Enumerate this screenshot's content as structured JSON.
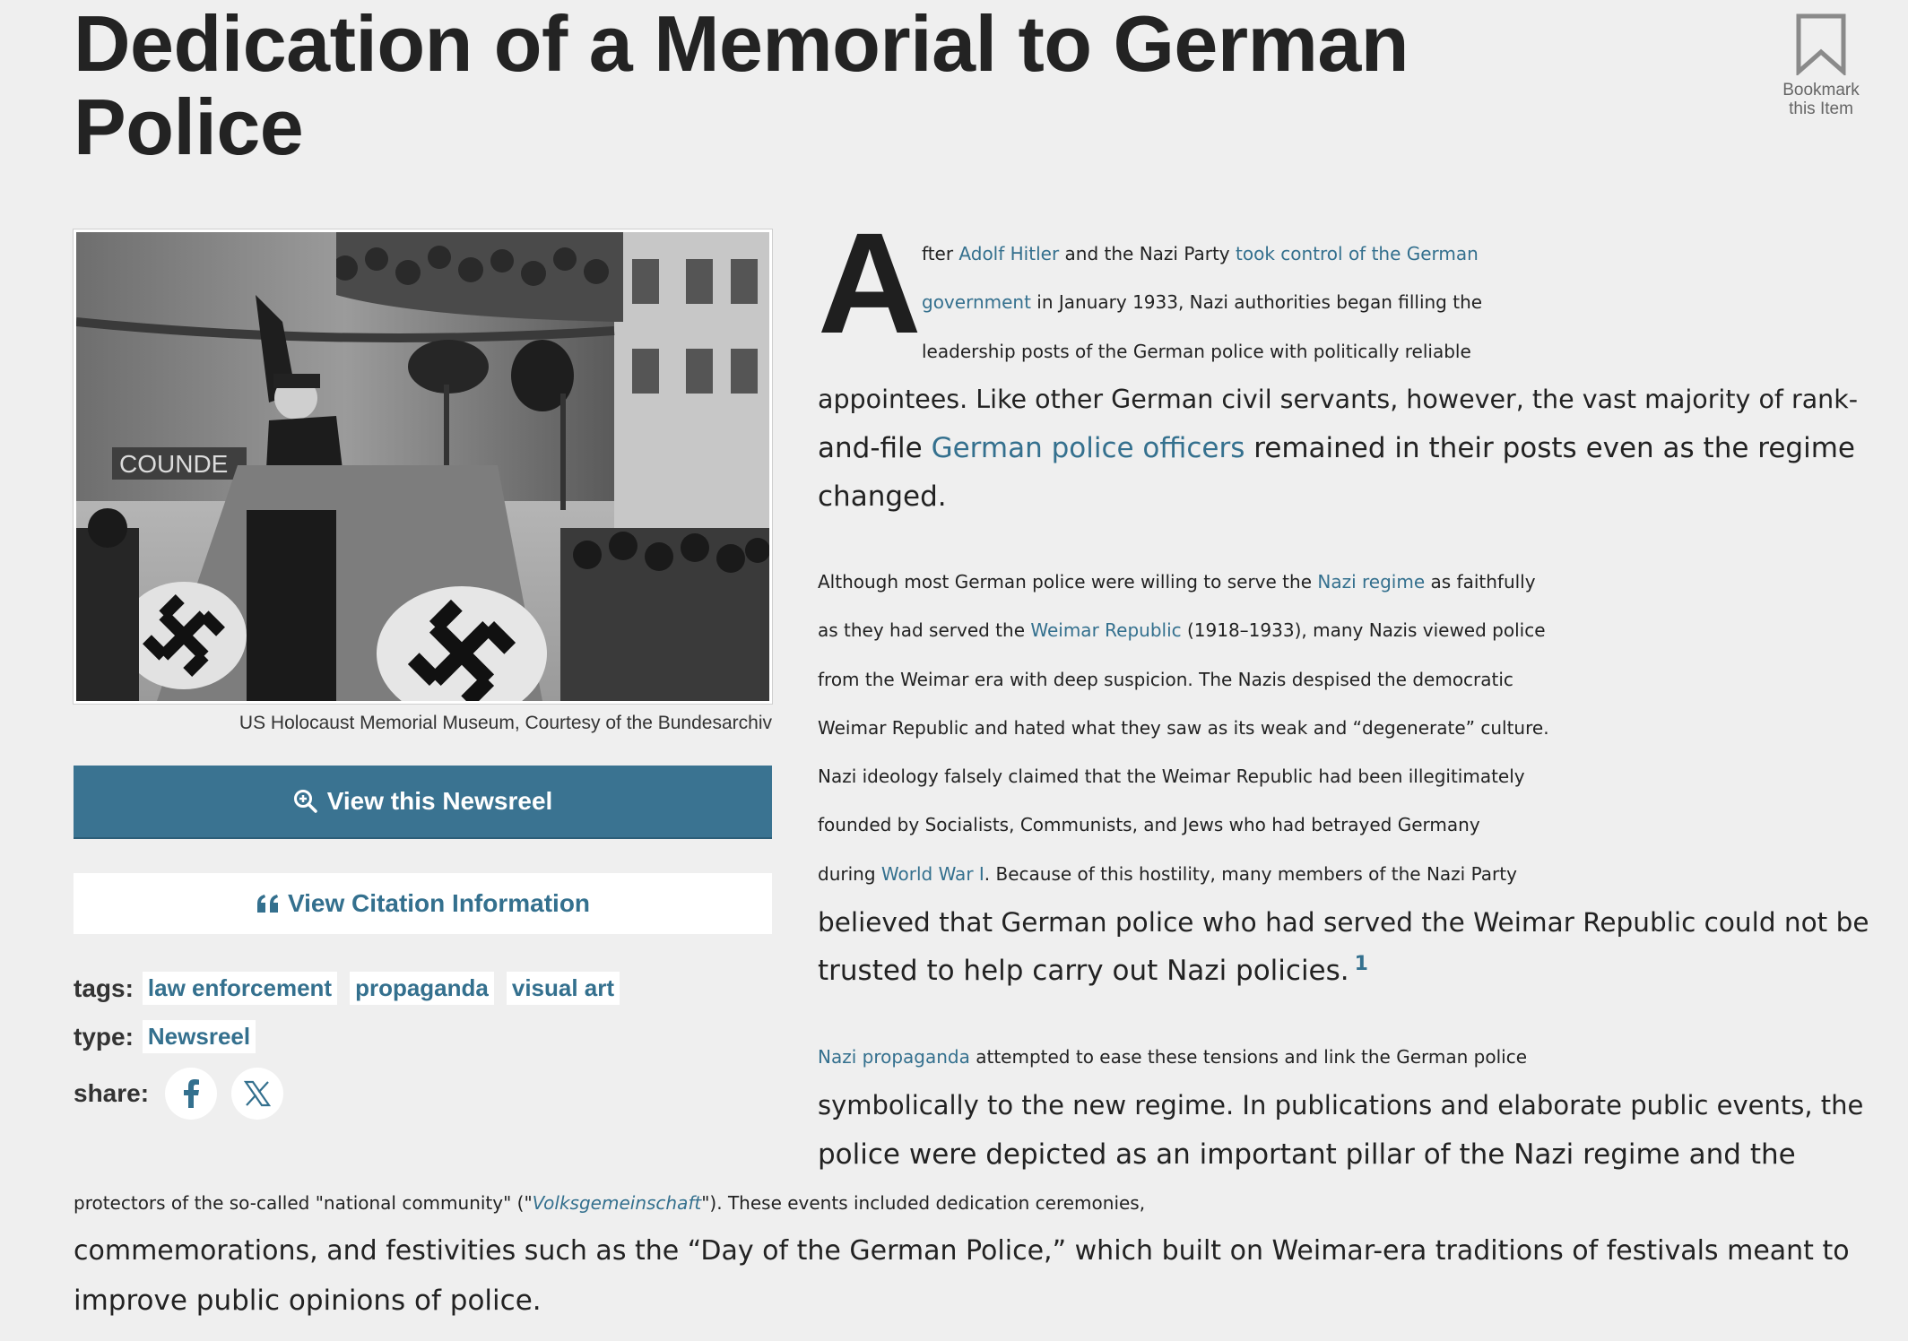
{
  "page": {
    "title_line1": "Dedication of a Memorial to German",
    "title_line2": "Police"
  },
  "bookmark": {
    "line1": "Bookmark",
    "line2": "this Item",
    "icon": "bookmark-icon"
  },
  "figure": {
    "caption": "US Holocaust Memorial Museum, Courtesy of the Bundesarchiv",
    "sign_text": "COUNDE"
  },
  "actions": {
    "view_newsreel": "View this Newsreel",
    "view_citation": "View Citation Information"
  },
  "meta": {
    "tags_label": "tags:",
    "tags": [
      "law enforcement",
      "propaganda",
      "visual art"
    ],
    "type_label": "type:",
    "type_value": "Newsreel",
    "share_label": "share:"
  },
  "article": {
    "dropcap": "A",
    "p1": {
      "l1a": "fter ",
      "l1_link1": "Adolf Hitler",
      "l1b": " and the Nazi Party ",
      "l1_link2": "took control of the German",
      "l2_link2": "government",
      "l2b": " in January 1933, Nazi authorities began filling the",
      "l3": "leadership posts of the German police with politically reliable",
      "l4": "appointees. Like other German civil servants, however, the vast majority of rank-",
      "l5a": "and-file ",
      "l5_link": "German police officers",
      "l5b": " remained in their posts even as the regime",
      "l6": "changed."
    },
    "p2": {
      "l1a": "Although most German police were willing to serve the ",
      "l1_link": "Nazi regime",
      "l1b": " as faithfully",
      "l2a": "as they had served the ",
      "l2_link": "Weimar Republic",
      "l2b": " (1918–1933), many Nazis viewed police",
      "l3": "from the Weimar era with deep suspicion. The Nazis despised the democratic",
      "l4": "Weimar Republic and hated what they saw as its weak and “degenerate” culture.",
      "l5": "Nazi ideology falsely claimed that the Weimar Republic had been illegitimately",
      "l6": "founded by Socialists, Communists, and Jews who had betrayed Germany",
      "l7a": "during ",
      "l7_link": "World War I",
      "l7b": ". Because of this hostility, many members of the Nazi Party",
      "l8": "believed that German police who had served the Weimar Republic could not be",
      "l9": "trusted to help carry out Nazi policies.",
      "footnote": "1"
    },
    "p3": {
      "l1_link": "Nazi propaganda",
      "l1b": " attempted to ease these tensions and link the German police",
      "l2": "symbolically to the new regime. In publications and elaborate public events, the",
      "l3": "police were depicted as an important pillar of the Nazi regime and the",
      "l4a": "protectors of the so-called \"national community\" (\"",
      "l4_link": "Volksgemeinschaft",
      "l4b": "\"). These events included dedication ceremonies,",
      "l5": "commemorations, and festivities such as the “Day of the German Police,” which built on Weimar-era traditions of festivals meant to",
      "l6": "improve public opinions of police."
    }
  }
}
